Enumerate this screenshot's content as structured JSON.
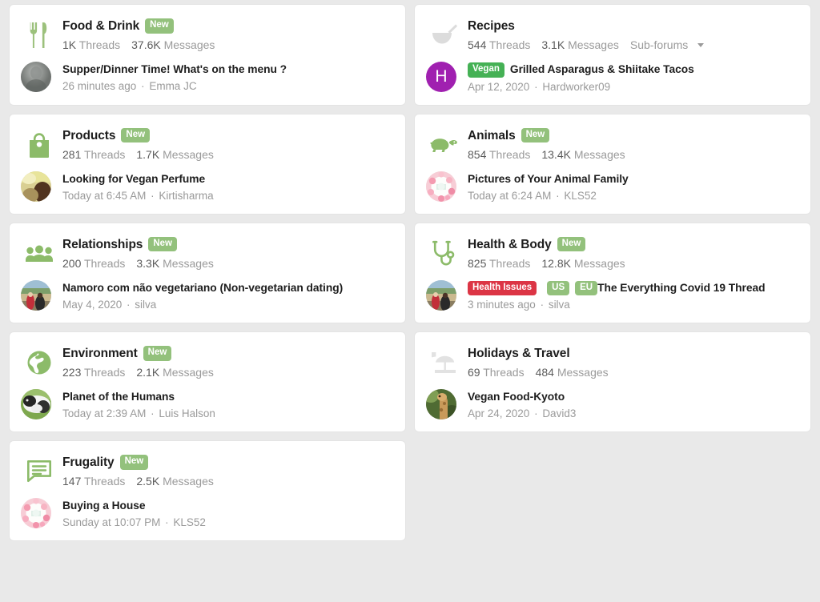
{
  "page": {
    "background": "#e9e9e9",
    "card_background": "#ffffff",
    "accent_green": "#93c17c",
    "vegan_green": "#45b155",
    "alert_red": "#dc3545"
  },
  "labels": {
    "threads": "Threads",
    "messages": "Messages",
    "subforums": "Sub-forums",
    "separator": "·"
  },
  "nodes": [
    {
      "id": "food-drink",
      "icon": "fork-knife-icon",
      "icon_color": "#9cc17c",
      "title": "Food & Drink",
      "badges": [
        {
          "text": "New",
          "style": "new"
        }
      ],
      "threads": "1K",
      "messages": "37.6K",
      "has_subforums": false,
      "last": {
        "avatar_type": "photo-gray",
        "avatar_letter": "",
        "avatar_color": "#8d8d8d",
        "prefixes": [],
        "title": "Supper/Dinner Time! What's on the menu ?",
        "time": "26 minutes ago",
        "user": "Emma JC"
      }
    },
    {
      "id": "recipes",
      "icon": "mortar-pestle-icon",
      "icon_color": "#dcdcdc",
      "title": "Recipes",
      "badges": [],
      "threads": "544",
      "messages": "3.1K",
      "has_subforums": true,
      "last": {
        "avatar_type": "letter",
        "avatar_letter": "H",
        "avatar_color": "#a020b0",
        "prefixes": [
          {
            "text": "Vegan",
            "style": "vegan"
          }
        ],
        "title": "Grilled Asparagus & Shiitake Tacos",
        "time": "Apr 12, 2020",
        "user": "Hardworker09"
      }
    },
    {
      "id": "products",
      "icon": "shopping-bag-icon",
      "icon_color": "#8cbb69",
      "title": "Products",
      "badges": [
        {
          "text": "New",
          "style": "new"
        }
      ],
      "threads": "281",
      "messages": "1.7K",
      "has_subforums": false,
      "last": {
        "avatar_type": "photo-field",
        "avatar_letter": "",
        "avatar_color": "#c7b27a",
        "prefixes": [],
        "title": "Looking for Vegan Perfume",
        "time": "Today at 6:45 AM",
        "user": "Kirtisharma"
      }
    },
    {
      "id": "animals",
      "icon": "turtle-icon",
      "icon_color": "#8cbb69",
      "title": "Animals",
      "badges": [
        {
          "text": "New",
          "style": "new"
        }
      ],
      "threads": "854",
      "messages": "13.4K",
      "has_subforums": false,
      "last": {
        "avatar_type": "photo-floral",
        "avatar_letter": "",
        "avatar_color": "#f4a6b8",
        "prefixes": [],
        "title": "Pictures of Your Animal Family",
        "time": "Today at 6:24 AM",
        "user": "KLS52"
      }
    },
    {
      "id": "relationships",
      "icon": "people-group-icon",
      "icon_color": "#8cbb69",
      "title": "Relationships",
      "badges": [
        {
          "text": "New",
          "style": "new"
        }
      ],
      "threads": "200",
      "messages": "3.3K",
      "has_subforums": false,
      "last": {
        "avatar_type": "photo-beach",
        "avatar_letter": "",
        "avatar_color": "#7fa3b5",
        "prefixes": [],
        "title": "Namoro com não vegetariano (Non-vegetarian dating)",
        "time": "May 4, 2020",
        "user": "silva"
      }
    },
    {
      "id": "health-body",
      "icon": "stethoscope-icon",
      "icon_color": "#8cbb69",
      "title": "Health & Body",
      "badges": [
        {
          "text": "New",
          "style": "new"
        }
      ],
      "threads": "825",
      "messages": "12.8K",
      "has_subforums": false,
      "last": {
        "avatar_type": "photo-beach",
        "avatar_letter": "",
        "avatar_color": "#7fa3b5",
        "prefixes": [
          {
            "text": "Health Issues",
            "style": "alert"
          },
          {
            "text": "US",
            "style": "pill"
          },
          {
            "text": "EU",
            "style": "pill"
          }
        ],
        "title": "The Everything Covid 19 Thread",
        "time": "3 minutes ago",
        "user": "silva"
      }
    },
    {
      "id": "environment",
      "icon": "globe-icon",
      "icon_color": "#8cbb69",
      "title": "Environment",
      "badges": [
        {
          "text": "New",
          "style": "new"
        }
      ],
      "threads": "223",
      "messages": "2.1K",
      "has_subforums": false,
      "last": {
        "avatar_type": "photo-cow",
        "avatar_letter": "",
        "avatar_color": "#5f7f4a",
        "prefixes": [],
        "title": "Planet of the Humans",
        "time": "Today at 2:39 AM",
        "user": "Luis Halson"
      }
    },
    {
      "id": "holidays-travel",
      "icon": "beach-umbrella-icon",
      "icon_color": "#e2e2e2",
      "title": "Holidays & Travel",
      "badges": [],
      "threads": "69",
      "messages": "484",
      "has_subforums": false,
      "last": {
        "avatar_type": "photo-giraffe",
        "avatar_letter": "",
        "avatar_color": "#6d7b4a",
        "prefixes": [],
        "title": "Vegan Food-Kyoto",
        "time": "Apr 24, 2020",
        "user": "David3"
      }
    },
    {
      "id": "frugality",
      "icon": "speech-bubble-icon",
      "icon_color": "#8cbb69",
      "title": "Frugality",
      "badges": [
        {
          "text": "New",
          "style": "new"
        }
      ],
      "threads": "147",
      "messages": "2.5K",
      "has_subforums": false,
      "last": {
        "avatar_type": "photo-floral",
        "avatar_letter": "",
        "avatar_color": "#f4a6b8",
        "prefixes": [],
        "title": "Buying a House",
        "time": "Sunday at 10:07 PM",
        "user": "KLS52"
      }
    }
  ]
}
